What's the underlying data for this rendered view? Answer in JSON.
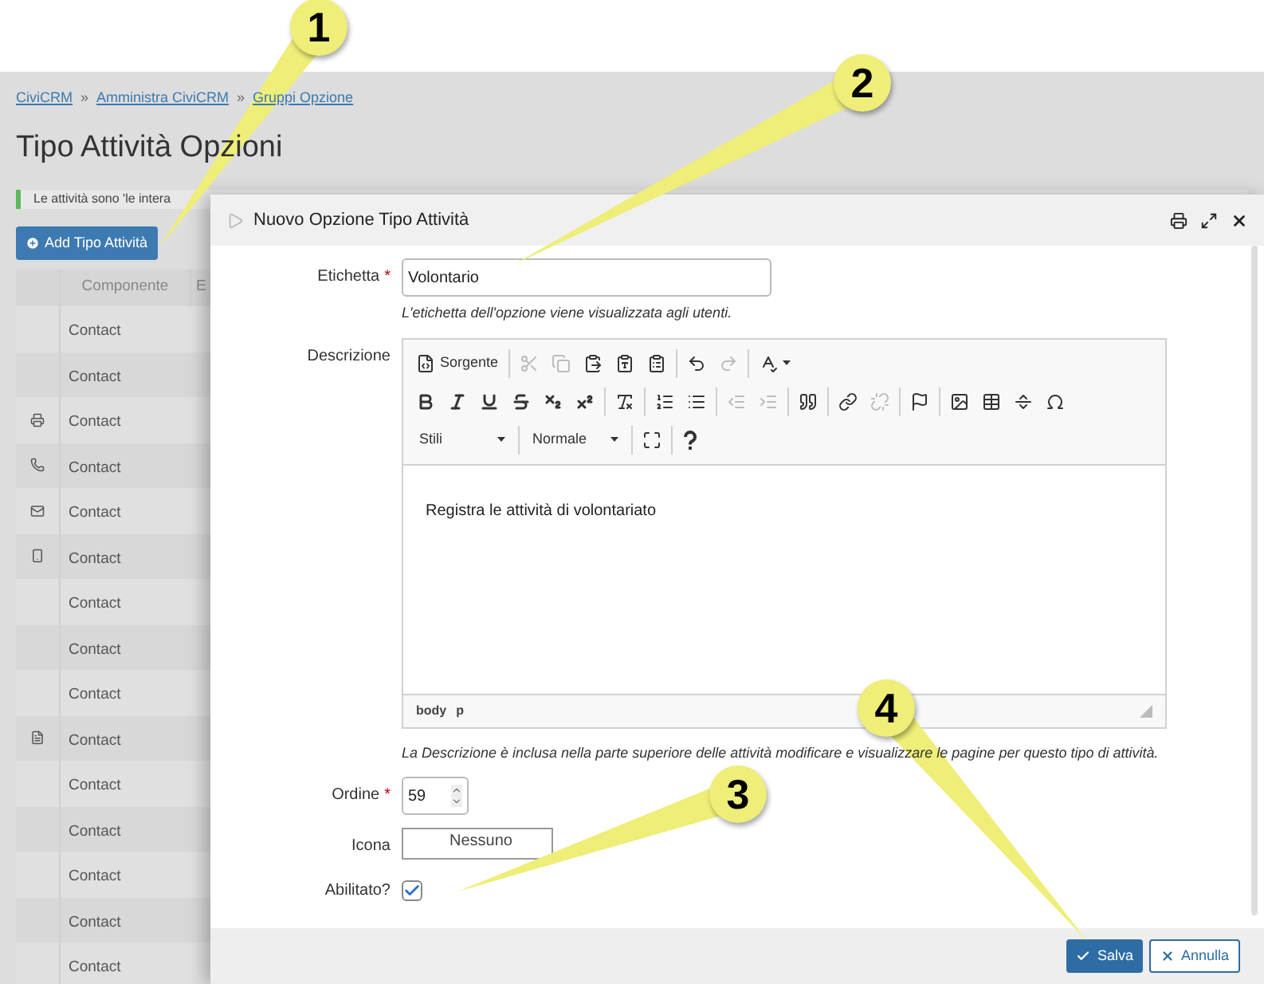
{
  "breadcrumb": {
    "items": [
      "CiviCRM",
      "Amministra CiviCRM",
      "Gruppi Opzione"
    ],
    "separator": "»"
  },
  "page_title": "Tipo Attività Opzioni",
  "alert": "Le attività sono 'le intera",
  "add_button": "Add Tipo Attività",
  "table": {
    "columns": [
      "Componente",
      "E"
    ],
    "rows": [
      {
        "kind": "plain",
        "component": "Contact"
      },
      {
        "kind": "plain",
        "component": "Contact"
      },
      {
        "kind": "fax",
        "component": "Contact"
      },
      {
        "kind": "phone",
        "component": "Contact"
      },
      {
        "kind": "mail",
        "component": "Contact"
      },
      {
        "kind": "mobile",
        "component": "Contact"
      },
      {
        "kind": "plain",
        "component": "Contact"
      },
      {
        "kind": "plain",
        "component": "Contact"
      },
      {
        "kind": "plain",
        "component": "Contact"
      },
      {
        "kind": "pdf",
        "component": "Contact"
      },
      {
        "kind": "plain",
        "component": "Contact"
      },
      {
        "kind": "plain",
        "component": "Contact"
      },
      {
        "kind": "plain",
        "component": "Contact"
      },
      {
        "kind": "plain",
        "component": "Contact"
      },
      {
        "kind": "plain",
        "component": "Contact"
      }
    ]
  },
  "dialog": {
    "title": "Nuovo Opzione Tipo Attività",
    "fields": [
      {
        "kind": "text",
        "label": "Etichetta",
        "required_mark": "*",
        "value": "Volontario",
        "help": "L'etichetta dell'opzione viene visualizzata agli utenti."
      },
      {
        "kind": "editor",
        "label": "Descrizione",
        "value": "Registra le attività di volontariato",
        "help": "La Descrizione è inclusa nella parte superiore delle attività modificare e visualizzare le pagine per questo tipo di attività.",
        "toolbar_rows": [
          [
            [
              {
                "kind": "button",
                "label": "Sorgente",
                "disabled": false
              }
            ],
            [
              {
                "kind": "button",
                "disabled": true
              },
              {
                "kind": "button",
                "disabled": true
              },
              {
                "kind": "button",
                "disabled": false
              },
              {
                "kind": "button",
                "disabled": false
              },
              {
                "kind": "button",
                "disabled": false
              }
            ],
            [
              {
                "kind": "button",
                "disabled": false
              },
              {
                "kind": "button",
                "disabled": true
              }
            ],
            [
              {
                "kind": "button",
                "disabled": false
              }
            ]
          ],
          [
            [
              {
                "kind": "button",
                "disabled": false
              },
              {
                "kind": "button",
                "disabled": false
              },
              {
                "kind": "button",
                "disabled": false
              },
              {
                "kind": "button",
                "disabled": false
              },
              {
                "kind": "button",
                "disabled": false
              },
              {
                "kind": "button",
                "disabled": false
              }
            ],
            [
              {
                "kind": "button",
                "disabled": false
              }
            ],
            [
              {
                "kind": "button",
                "disabled": false
              },
              {
                "kind": "button",
                "disabled": false
              }
            ],
            [
              {
                "kind": "button",
                "disabled": true
              },
              {
                "kind": "button",
                "disabled": true
              }
            ],
            [
              {
                "kind": "button",
                "disabled": false
              }
            ],
            [
              {
                "kind": "button",
                "disabled": false
              },
              {
                "kind": "button",
                "disabled": true
              }
            ],
            [
              {
                "kind": "button",
                "disabled": false
              }
            ],
            [
              {
                "kind": "button",
                "disabled": false
              },
              {
                "kind": "button",
                "disabled": false
              },
              {
                "kind": "button",
                "disabled": false
              },
              {
                "kind": "button",
                "disabled": false
              }
            ]
          ],
          [
            [
              {
                "kind": "dropdown",
                "label": "Stili",
                "disabled": false
              }
            ],
            [
              {
                "kind": "dropdown",
                "label": "Normale",
                "disabled": false
              }
            ],
            [
              {
                "kind": "button",
                "disabled": false
              }
            ],
            [
              {
                "kind": "button",
                "disabled": false
              }
            ]
          ]
        ],
        "path": [
          "body",
          "p"
        ]
      },
      {
        "kind": "number",
        "label": "Ordine",
        "required_mark": "*",
        "value": "59"
      },
      {
        "kind": "select",
        "label": "Icona",
        "value": "Nessuno"
      },
      {
        "kind": "checkbox",
        "label": "Abilitato?",
        "checked": true
      }
    ],
    "buttons": [
      {
        "kind": "primary",
        "label": "Salva"
      },
      {
        "kind": "secondary",
        "label": "Annulla"
      }
    ]
  },
  "callouts": [
    {
      "label": "1"
    },
    {
      "label": "2"
    },
    {
      "label": "3"
    },
    {
      "label": "4"
    }
  ]
}
